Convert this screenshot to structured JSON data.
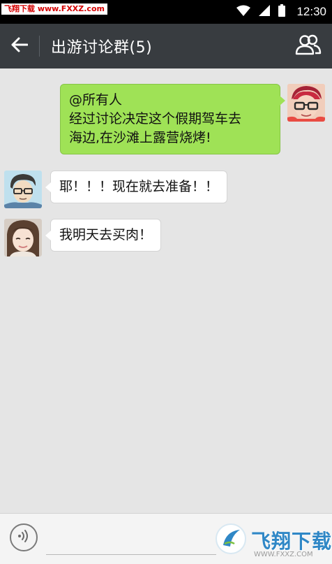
{
  "status_bar": {
    "watermark_label": "飞翔下载",
    "watermark_url": "www.FXXZ.com",
    "time": "12:30",
    "icons": [
      "wifi-icon",
      "signal-icon",
      "battery-icon"
    ]
  },
  "header": {
    "title": "出游讨论群(5)",
    "back_icon": "back-arrow-icon",
    "members_icon": "group-members-icon"
  },
  "messages": [
    {
      "direction": "outgoing",
      "lines": [
        "@所有人",
        "经过讨论决定这个假期驾车去",
        "海边,在沙滩上露营烧烤!"
      ]
    },
    {
      "direction": "incoming",
      "text": "耶！！！现在就去准备！！"
    },
    {
      "direction": "incoming",
      "text": "我明天去买肉！"
    }
  ],
  "input_bar": {
    "voice_icon": "voice-icon",
    "input_value": "",
    "watermark_text": "飞翔下载",
    "watermark_sub": "WWW.FXXZ.COM"
  },
  "colors": {
    "header_bg": "#383c40",
    "chat_bg": "#e5e5e5",
    "outgoing_bubble": "#9fe256",
    "incoming_bubble": "#ffffff"
  }
}
